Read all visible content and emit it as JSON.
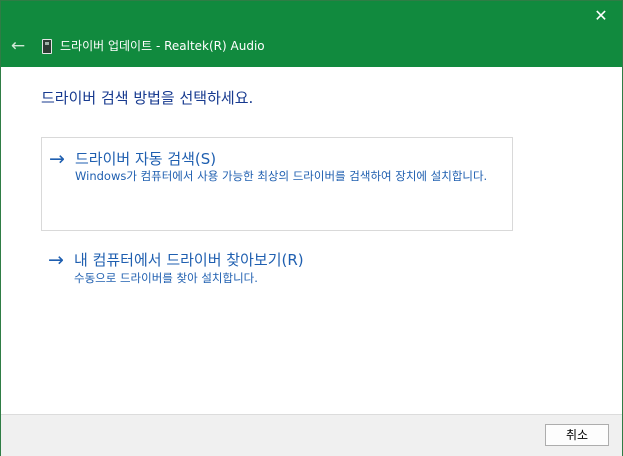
{
  "titlebar": {
    "title": "드라이버 업데이트 - Realtek(R) Audio",
    "back_icon": "←",
    "close_icon": "✕",
    "background_color": "#118a3e"
  },
  "main": {
    "heading": "드라이버 검색 방법을 선택하세요.",
    "options": [
      {
        "arrow": "→",
        "title": "드라이버 자동 검색(S)",
        "description": "Windows가 컴퓨터에서 사용 가능한 최상의 드라이버를 검색하여 장치에 설치합니다.",
        "selected": true
      },
      {
        "arrow": "→",
        "title": "내 컴퓨터에서 드라이버 찾아보기(R)",
        "description": "수동으로 드라이버를 찾아 설치합니다.",
        "selected": false
      }
    ],
    "link_color": "#1f5fb0"
  },
  "footer": {
    "cancel_label": "취소"
  }
}
